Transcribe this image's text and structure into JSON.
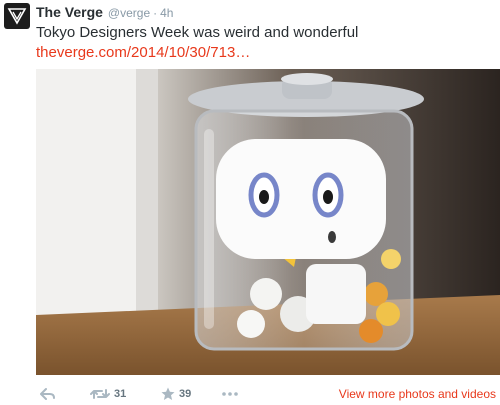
{
  "tweet": {
    "display_name": "The Verge",
    "handle": "@verge",
    "separator": "·",
    "time": "4h",
    "text": "Tokyo Designers Week was weird and wonderful",
    "link": "theverge.com/2014/10/30/713…",
    "avatar_icon": "verge-logo-icon"
  },
  "photo": {
    "alt_subject": "glass jar with cartoon face figure and candy"
  },
  "actions": {
    "reply_icon": "reply-arrow-icon",
    "retweet_icon": "retweet-icon",
    "retweet_count": "31",
    "favorite_icon": "star-icon",
    "favorite_count": "39",
    "more_icon": "ellipsis-icon",
    "more_photos_label": "View more photos and videos"
  },
  "colors": {
    "link": "#e8391c",
    "meta": "#8899a6",
    "action_icon": "#aab8c2"
  }
}
